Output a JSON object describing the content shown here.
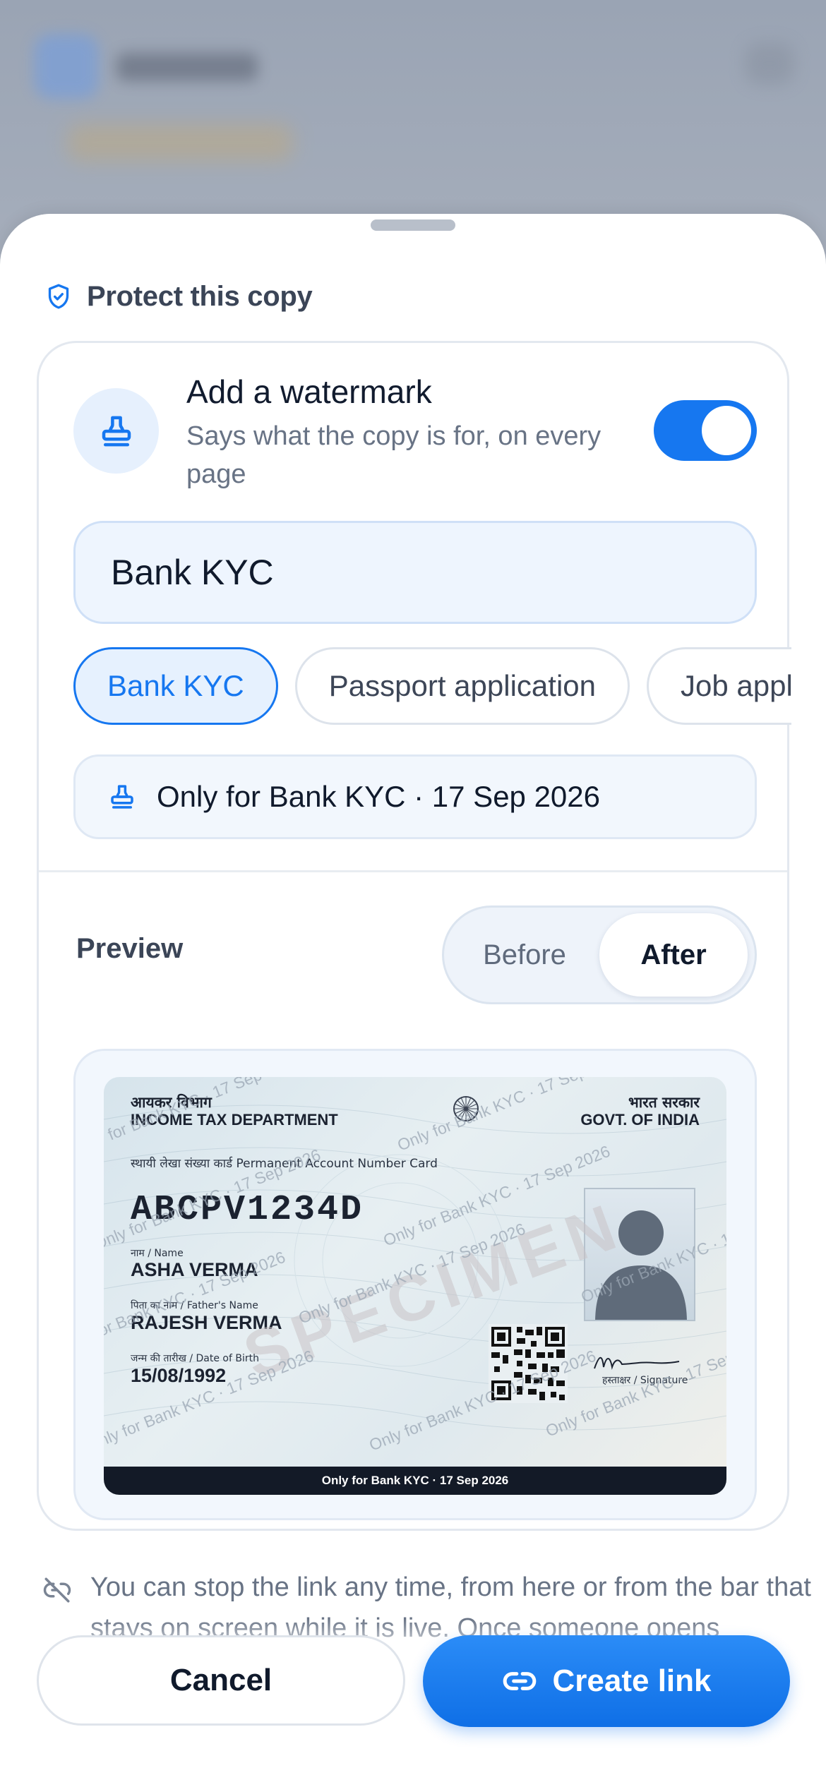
{
  "section": {
    "title": "Protect this copy",
    "icon": "shield-check-icon"
  },
  "watermark": {
    "title": "Add a watermark",
    "description": "Says what the copy is for, on every page",
    "enabled": true,
    "input_value": "Bank KYC",
    "suggestions": [
      "Bank KYC",
      "Passport application",
      "Job appli"
    ],
    "selected_suggestion": "Bank KYC",
    "summary_text": "Only for Bank KYC · 17 Sep 2026",
    "icon": "stamp-icon"
  },
  "preview": {
    "label": "Preview",
    "segments": {
      "before": "Before",
      "after": "After"
    },
    "selected": "After"
  },
  "pan_card": {
    "hindi_left": "आयकर विभाग",
    "dept": "INCOME TAX DEPARTMENT",
    "hindi_right": "भारत सरकार",
    "govt": "GOVT. OF INDIA",
    "card_label": "स्थायी लेखा संख्या कार्ड   Permanent Account Number Card",
    "pan_number": "ABCPV1234D",
    "name_label": "नाम / Name",
    "name": "ASHA VERMA",
    "father_label": "पिता का नाम / Father's Name",
    "father_name": "RAJESH VERMA",
    "dob_label": "जन्म की तारीख / Date of Birth",
    "dob": "15/08/1992",
    "signature_label": "हस्ताक्षर / Signature",
    "specimen": "SPECIMEN",
    "watermark_text": "Only for Bank KYC · 17 Sep 2026",
    "footer_strip": "Only for Bank KYC · 17 Sep 2026"
  },
  "info": {
    "text": "You can stop the link any time, from here or from the bar that stays on screen while it is live. Once someone opens",
    "icon": "link-off-icon"
  },
  "actions": {
    "cancel": "Cancel",
    "create": "Create link",
    "create_icon": "link-icon"
  },
  "colors": {
    "accent": "#1677f0",
    "text": "#101a2c",
    "muted": "#687385"
  }
}
